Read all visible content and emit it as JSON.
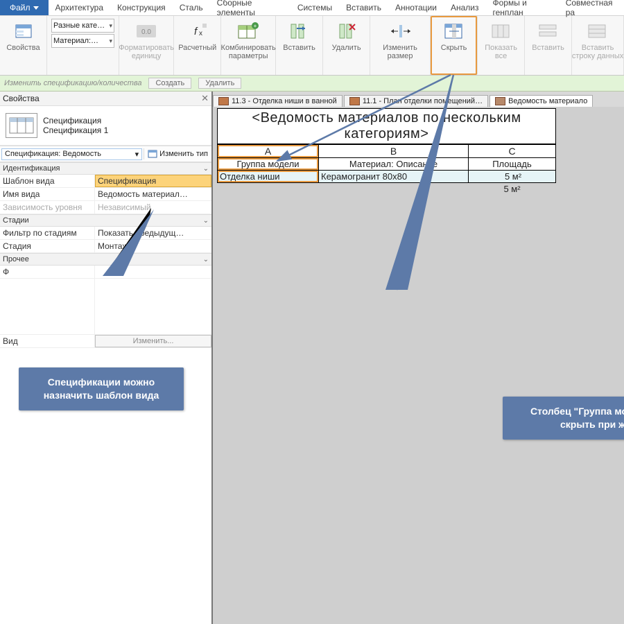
{
  "menu": {
    "file": "Файл",
    "arch": "Архитектура",
    "kon": "Конструкция",
    "steel": "Сталь",
    "precast": "Сборные элементы",
    "sys": "Системы",
    "insert": "Вставить",
    "ann": "Аннотации",
    "anal": "Анализ",
    "mass": "Формы и генплан",
    "collab": "Совместная ра"
  },
  "ribbon": {
    "props": "Свойства",
    "cat_label": "Разные кате…",
    "mat_label": "Материал:…",
    "format": "Форматировать\nединицу",
    "calc": "Расчетный",
    "combine": "Комбинировать\nпараметры",
    "insert": "Вставить",
    "delete": "Удалить",
    "resize": "Изменить размер",
    "hide": "Скрыть",
    "showall": "Показать\nвсе",
    "insert2": "Вставить",
    "insert_row": "Вставить\nстроку данных"
  },
  "subbar": {
    "title": "Изменить спецификацию/количества",
    "create": "Создать",
    "delete": "Удалить"
  },
  "props": {
    "title": "Свойства",
    "type1": "Спецификация",
    "type2": "Спецификация 1",
    "selector": "Спецификация: Ведомость",
    "edit": "Изменить тип",
    "g_ident": "Идентификация",
    "k_tmpl": "Шаблон вида",
    "v_tmpl": "Спецификация",
    "k_name": "Имя вида",
    "v_name": "Ведомость материал…",
    "k_dep": "Зависимость уровня",
    "v_dep": "Независимый",
    "g_stad": "Стадии",
    "k_filter": "Фильтр по стадиям",
    "v_filter": "Показать предыдущ…",
    "k_stage": "Стадия",
    "v_stage": "Монтаж",
    "g_proc": "Прочее",
    "k_f": "Ф",
    "k_vid": "Вид",
    "btn": "Изменить..."
  },
  "tabs": {
    "t1": "11.3 - Отделка ниши в ванной",
    "t2": "11.1 - План отделки помещений…",
    "t3": "Ведомость материало"
  },
  "sched": {
    "title": "<Ведомость материалов по нескольким категориям>",
    "A": "A",
    "B": "B",
    "C": "C",
    "hA": "Группа модели",
    "hB": "Материал: Описание",
    "hC": "Площадь",
    "rA": "Отделка ниши",
    "rB": "Керамогранит 80х80",
    "rC": "5 м²",
    "tC": "5 м²"
  },
  "call1": "Спецификации можно назначить шаблон вида",
  "call2": "Столбец \"Группа модели\" можно скрыть при желании"
}
